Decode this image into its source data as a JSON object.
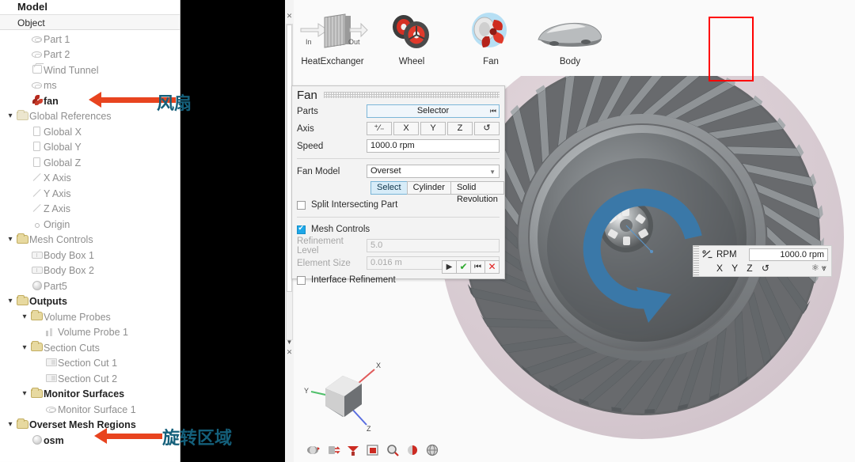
{
  "window": {
    "title": "Model"
  },
  "tree": {
    "title": "Model",
    "column_header": "Object",
    "items": [
      {
        "label": "Part 1",
        "icon": "part-icon",
        "indent": 2,
        "chevron": "",
        "style": "muted"
      },
      {
        "label": "Part 2",
        "icon": "part-icon",
        "indent": 2,
        "chevron": "",
        "style": "muted"
      },
      {
        "label": "Wind Tunnel",
        "icon": "cube-icon",
        "indent": 2,
        "chevron": "",
        "style": "muted"
      },
      {
        "label": "ms",
        "icon": "part-icon",
        "indent": 2,
        "chevron": "",
        "style": "muted"
      },
      {
        "label": "fan",
        "icon": "fan-icon",
        "indent": 2,
        "chevron": "",
        "style": "bold"
      },
      {
        "label": "Global References",
        "icon": "folder-pale-icon",
        "indent": 1,
        "chevron": "▾",
        "style": "muted"
      },
      {
        "label": "Global X",
        "icon": "square-icon",
        "indent": 2,
        "chevron": "",
        "style": "muted"
      },
      {
        "label": "Global Y",
        "icon": "square-icon",
        "indent": 2,
        "chevron": "",
        "style": "muted"
      },
      {
        "label": "Global Z",
        "icon": "square-icon",
        "indent": 2,
        "chevron": "",
        "style": "muted"
      },
      {
        "label": "X Axis",
        "icon": "axis-icon",
        "indent": 2,
        "chevron": "",
        "style": "muted"
      },
      {
        "label": "Y Axis",
        "icon": "axis-icon",
        "indent": 2,
        "chevron": "",
        "style": "muted"
      },
      {
        "label": "Z Axis",
        "icon": "axis-icon",
        "indent": 2,
        "chevron": "",
        "style": "muted"
      },
      {
        "label": "Origin",
        "icon": "origin-icon",
        "indent": 2,
        "chevron": "",
        "style": "muted"
      },
      {
        "label": "Mesh Controls",
        "icon": "folder-icon",
        "indent": 1,
        "chevron": "▾",
        "style": "muted"
      },
      {
        "label": "Body Box 1",
        "icon": "bodybox-icon",
        "indent": 2,
        "chevron": "",
        "style": "muted"
      },
      {
        "label": "Body Box 2",
        "icon": "bodybox-icon",
        "indent": 2,
        "chevron": "",
        "style": "muted"
      },
      {
        "label": "Part5",
        "icon": "ball-icon",
        "indent": 2,
        "chevron": "",
        "style": "muted"
      },
      {
        "label": "Outputs",
        "icon": "folder-icon",
        "indent": 1,
        "chevron": "▾",
        "style": "bold"
      },
      {
        "label": "Volume Probes",
        "icon": "folder-icon",
        "indent": 2,
        "chevron": "▾",
        "style": "muted"
      },
      {
        "label": "Volume Probe 1",
        "icon": "probe-icon",
        "indent": 3,
        "chevron": "",
        "style": "muted"
      },
      {
        "label": "Section Cuts",
        "icon": "folder-icon",
        "indent": 2,
        "chevron": "▾",
        "style": "muted"
      },
      {
        "label": "Section Cut 1",
        "icon": "section-icon",
        "indent": 3,
        "chevron": "",
        "style": "muted"
      },
      {
        "label": "Section Cut 2",
        "icon": "section-icon",
        "indent": 3,
        "chevron": "",
        "style": "muted"
      },
      {
        "label": "Monitor Surfaces",
        "icon": "folder-icon",
        "indent": 2,
        "chevron": "▾",
        "style": "bold"
      },
      {
        "label": "Monitor Surface 1",
        "icon": "part-icon",
        "indent": 3,
        "chevron": "",
        "style": "muted"
      },
      {
        "label": "Overset Mesh Regions",
        "icon": "folder-icon",
        "indent": 1,
        "chevron": "▾",
        "style": "bold"
      },
      {
        "label": "osm",
        "icon": "ball-icon",
        "indent": 2,
        "chevron": "",
        "style": "bold"
      }
    ]
  },
  "annotations": [
    {
      "name": "fan-annotation",
      "text": "风扇",
      "color": "#145f7a"
    },
    {
      "name": "osm-annotation",
      "text": "旋转区域",
      "color": "#145f7a"
    }
  ],
  "ribbon": {
    "items": [
      {
        "label": "HeatExchanger",
        "icon": "heat-exchanger-icon",
        "in_label": "In",
        "out_label": "Out",
        "selected": false
      },
      {
        "label": "Wheel",
        "icon": "wheel-icon",
        "selected": false
      },
      {
        "label": "Fan",
        "icon": "fan-icon",
        "selected": true
      },
      {
        "label": "Body",
        "icon": "car-body-icon",
        "selected": false
      }
    ],
    "highlight_color": "#ff0000"
  },
  "fan_dialog": {
    "title": "Fan",
    "parts": {
      "label": "Parts",
      "value": "Selector"
    },
    "axis": {
      "label": "Axis",
      "buttons": [
        "⁺⁄₋",
        "X",
        "Y",
        "Z",
        "↺"
      ]
    },
    "speed": {
      "label": "Speed",
      "value": "1000.0 rpm"
    },
    "fan_model": {
      "label": "Fan Model",
      "value": "Overset"
    },
    "model_segments": {
      "options": [
        "Select",
        "Cylinder",
        "Solid Revolution"
      ],
      "selected": "Select"
    },
    "split_intersecting": {
      "label": "Split Intersecting Part",
      "checked": false
    },
    "mesh_controls": {
      "label": "Mesh Controls",
      "checked": true
    },
    "refinement_level": {
      "label": "Refinement Level",
      "value": "5.0",
      "enabled": false
    },
    "element_size": {
      "label": "Element Size",
      "value": "0.016 m",
      "enabled": false
    },
    "interface_refinement": {
      "label": "Interface Refinement",
      "checked": false
    },
    "buttons": [
      {
        "name": "preview-button",
        "glyph": "▶"
      },
      {
        "name": "accept-button",
        "glyph": "✔"
      },
      {
        "name": "apply-button",
        "glyph": "⏮"
      },
      {
        "name": "cancel-button",
        "glyph": "✕"
      }
    ]
  },
  "rpm_widget": {
    "icon": "rpm-icon",
    "label": "RPM",
    "value": "1000.0 rpm",
    "axis_labels": "X Y Z ↺",
    "trailing_icons": [
      "snap-icon",
      "expand-icon"
    ]
  },
  "viewport": {
    "toolbar": [
      {
        "name": "rotate-tool",
        "glyph": "rotate"
      },
      {
        "name": "pan-tool",
        "glyph": "pan"
      },
      {
        "name": "clip-tool",
        "glyph": "clip"
      },
      {
        "name": "fit-view-tool",
        "glyph": "fit"
      },
      {
        "name": "zoom-tool",
        "glyph": "zoom"
      },
      {
        "name": "section-tool",
        "glyph": "section"
      },
      {
        "name": "globe-tool",
        "glyph": "globe"
      }
    ],
    "triad": {
      "x_label": "X",
      "y_label": "Y",
      "z_label": "Z"
    },
    "model": {
      "name": "centrifugal-fan",
      "blade_count": 34,
      "overset_region_color": "#d9ccd2",
      "blade_color": "#8b8f92",
      "hub_color": "#6f7376",
      "rotation_arrow_color": "#3a78a8"
    }
  }
}
